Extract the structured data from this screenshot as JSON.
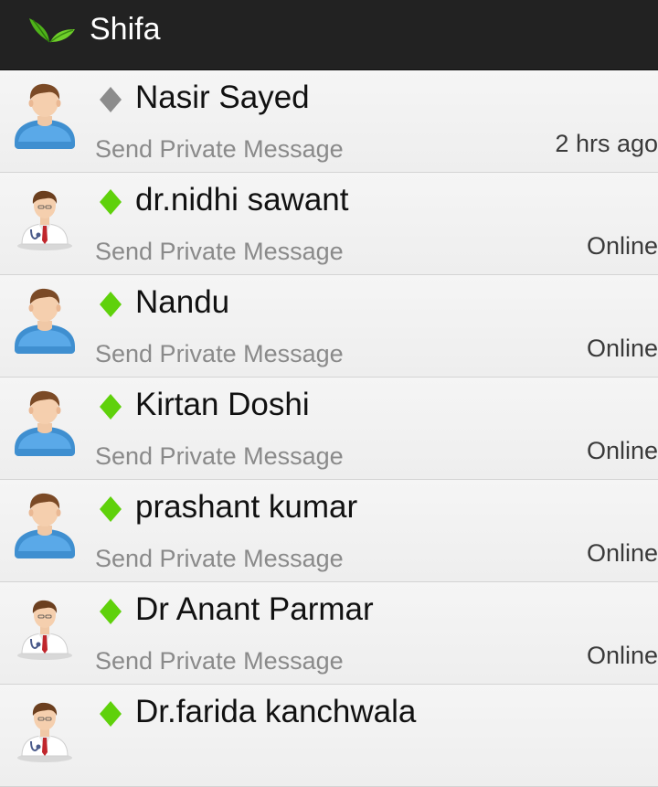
{
  "app": {
    "title": "Shifa",
    "logo_icon": "leaf-logo-icon"
  },
  "colors": {
    "online": "#5fd10b",
    "offline": "#8c8c8c",
    "header_bg": "#222222",
    "row_bg": "#f2f2f2"
  },
  "contacts": [
    {
      "name": "Nasir Sayed",
      "action": "Send Private Message",
      "status": "2 hrs ago",
      "presence": "offline",
      "avatar": "patient-avatar-icon"
    },
    {
      "name": "dr.nidhi sawant",
      "action": "Send Private Message",
      "status": "Online",
      "presence": "online",
      "avatar": "doctor-avatar-icon"
    },
    {
      "name": "Nandu",
      "action": "Send Private Message",
      "status": "Online",
      "presence": "online",
      "avatar": "patient-avatar-icon"
    },
    {
      "name": "Kirtan Doshi",
      "action": "Send Private Message",
      "status": "Online",
      "presence": "online",
      "avatar": "patient-avatar-icon"
    },
    {
      "name": "prashant kumar",
      "action": "Send Private Message",
      "status": "Online",
      "presence": "online",
      "avatar": "patient-avatar-icon"
    },
    {
      "name": "Dr Anant Parmar",
      "action": "Send Private Message",
      "status": "Online",
      "presence": "online",
      "avatar": "doctor-avatar-icon"
    },
    {
      "name": "Dr.farida kanchwala",
      "action": "",
      "status": "",
      "presence": "online",
      "avatar": "doctor-avatar-icon"
    }
  ]
}
